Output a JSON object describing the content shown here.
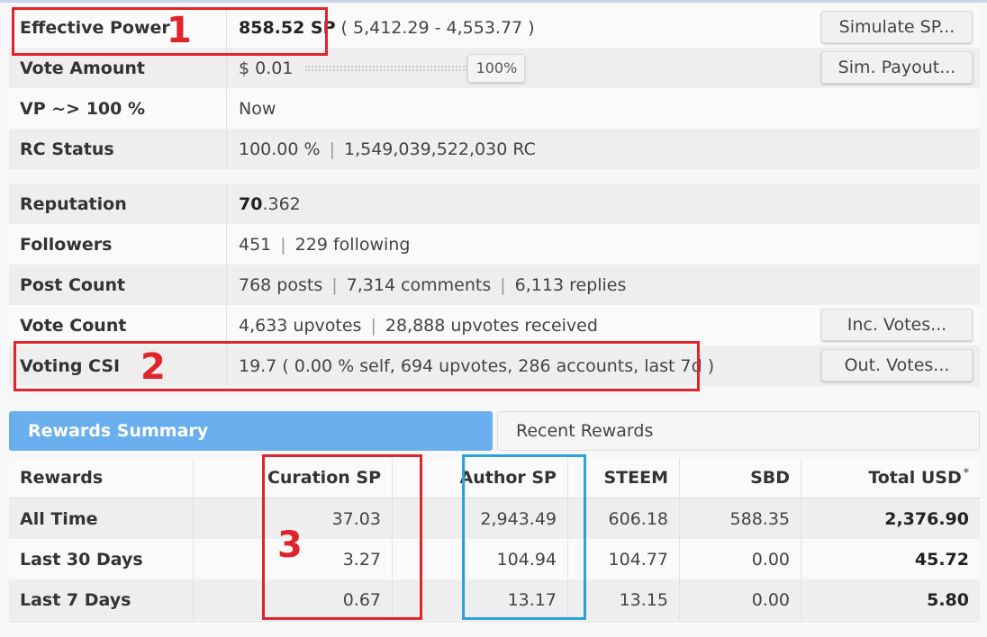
{
  "stats": {
    "effective_power": {
      "label": "Effective Power",
      "value": "858.52 SP",
      "detail": "( 5,412.29 - 4,553.77 )",
      "button": "Simulate SP..."
    },
    "vote_amount": {
      "label": "Vote Amount",
      "value": "$ 0.01",
      "percent": "100%",
      "button": "Sim. Payout..."
    },
    "vp": {
      "label": "VP ~> 100 %",
      "value": "Now"
    },
    "rc_status": {
      "label": "RC Status",
      "percent": "100.00 %",
      "rc": "1,549,039,522,030 RC"
    },
    "reputation": {
      "label": "Reputation",
      "value_int": "70",
      "value_dec": ".362"
    },
    "followers": {
      "label": "Followers",
      "count": "451",
      "following": "229 following"
    },
    "post_count": {
      "label": "Post Count",
      "posts": "768 posts",
      "comments": "7,314 comments",
      "replies": "6,113 replies"
    },
    "vote_count": {
      "label": "Vote Count",
      "upvotes": "4,633 upvotes",
      "received": "28,888 upvotes received",
      "button": "Inc. Votes..."
    },
    "voting_csi": {
      "label": "Voting CSI",
      "value": "19.7 ( 0.00 % self, 694 upvotes, 286 accounts, last 7d )",
      "button": "Out. Votes..."
    }
  },
  "tabs": {
    "active": "Rewards Summary",
    "inactive": "Recent Rewards"
  },
  "rewards": {
    "headers": [
      "Rewards",
      "Curation SP",
      "Author SP",
      "STEEM",
      "SBD",
      "Total USD"
    ],
    "footnote_mark": "*",
    "rows": [
      {
        "period": "All Time",
        "curation_sp": "37.03",
        "author_sp": "2,943.49",
        "steem": "606.18",
        "sbd": "588.35",
        "total_usd": "2,376.90"
      },
      {
        "period": "Last 30 Days",
        "curation_sp": "3.27",
        "author_sp": "104.94",
        "steem": "104.77",
        "sbd": "0.00",
        "total_usd": "45.72"
      },
      {
        "period": "Last 7 Days",
        "curation_sp": "0.67",
        "author_sp": "13.17",
        "steem": "13.15",
        "sbd": "0.00",
        "total_usd": "5.80"
      }
    ]
  },
  "annotations": {
    "box1": "1",
    "box2": "2",
    "box3": "3"
  },
  "colors": {
    "accent": "#6aafed",
    "annotation_red": "#e0242c",
    "annotation_blue": "#2aa3dc"
  }
}
